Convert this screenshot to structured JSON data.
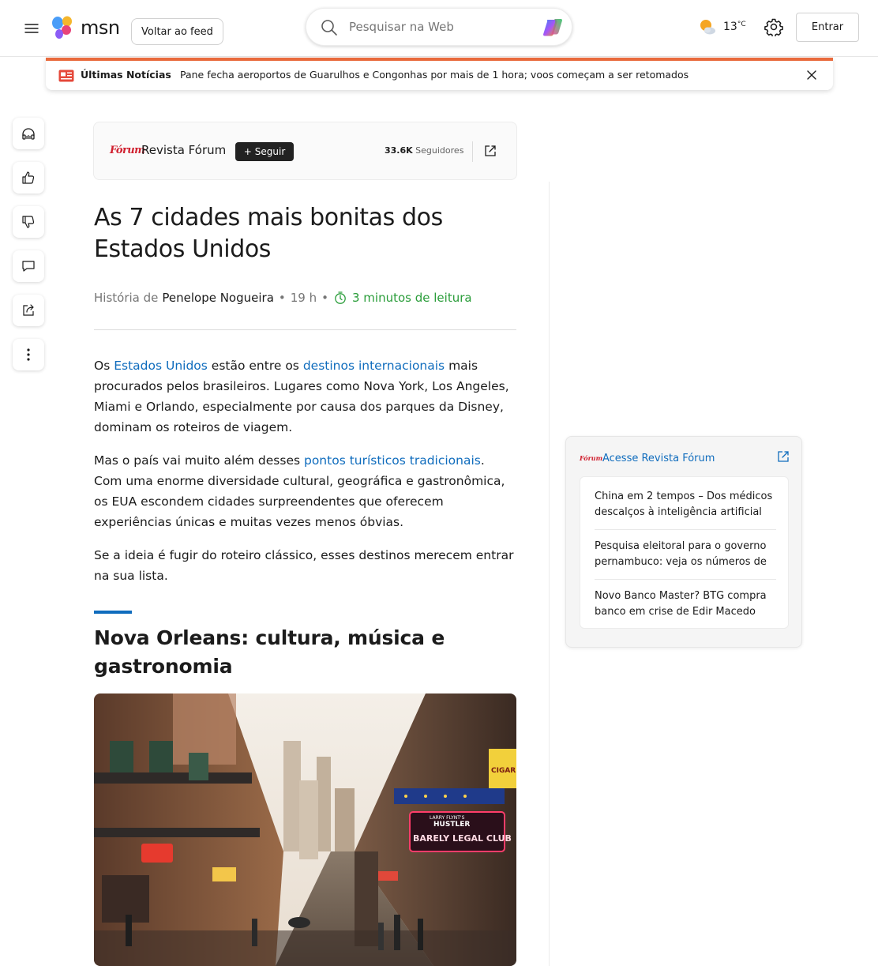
{
  "header": {
    "logo_text": "msn",
    "back_label": "Voltar ao feed",
    "search_placeholder": "Pesquisar na Web",
    "weather_temp": "13",
    "weather_unit": "°C",
    "login_label": "Entrar"
  },
  "breaking": {
    "label": "Últimas Notícias",
    "text": "Pane fecha aeroportos de Guarulhos e Congonhas por mais de 1 hora; voos começam a ser retomados"
  },
  "publisher": {
    "logo": "Fórum",
    "name": "Revista Fórum",
    "follow_label": "Seguir",
    "followers_count": "33.6K",
    "followers_label": "Seguidores"
  },
  "article": {
    "title": "As 7 cidades mais bonitas dos Estados Unidos",
    "byline_prefix": "História de",
    "author": "Penelope Nogueira",
    "time_ago": "19 h",
    "read_time": "3 minutos de leitura",
    "p1": {
      "t1": "Os ",
      "link1": "Estados Unidos",
      "t2": " estão entre os ",
      "link2": "destinos internacionais",
      "t3": " mais procurados pelos brasileiros. Lugares como Nova York, Los Angeles, Miami e Orlando, especialmente por causa dos parques da Disney, dominam os roteiros de viagem."
    },
    "p2": {
      "t1": "Mas o país vai muito além desses ",
      "link1": "pontos turísticos tradicionais",
      "t2": ". Com uma enorme diversidade cultural, geográfica e gastronômica, os EUA escondem cidades surpreendentes que oferecem experiências únicas e muitas vezes menos óbvias."
    },
    "p3": "Se a ideia é fugir do roteiro clássico, esses destinos merecem entrar na sua lista.",
    "section_heading": "Nova Orleans: cultura, música e gastronomia",
    "photo_signs": {
      "cigar": "CIGAR CIGAR",
      "larry": "LARRY FLYNT'S",
      "hustler": "HUSTLER",
      "barely": "BARELY LEGAL CLUB"
    }
  },
  "widget": {
    "logo": "Fórum",
    "title": "Acesse Revista Fórum",
    "items": [
      "China em 2 tempos – Dos médicos descalços à inteligência artificial",
      "Pesquisa eleitoral para o governo pernambuco: veja os números de",
      "Novo Banco Master? BTG compra banco em crise de Edir Macedo"
    ]
  },
  "colors": {
    "accent_blue": "#0f6cbd",
    "breaking_orange": "#e96a3c",
    "read_time_green": "#2a9d3a",
    "publisher_red": "#d0202f"
  },
  "icons": {
    "rail": [
      "headphones-icon",
      "thumbs-up-icon",
      "thumbs-down-icon",
      "comment-icon",
      "share-icon",
      "more-icon"
    ]
  }
}
